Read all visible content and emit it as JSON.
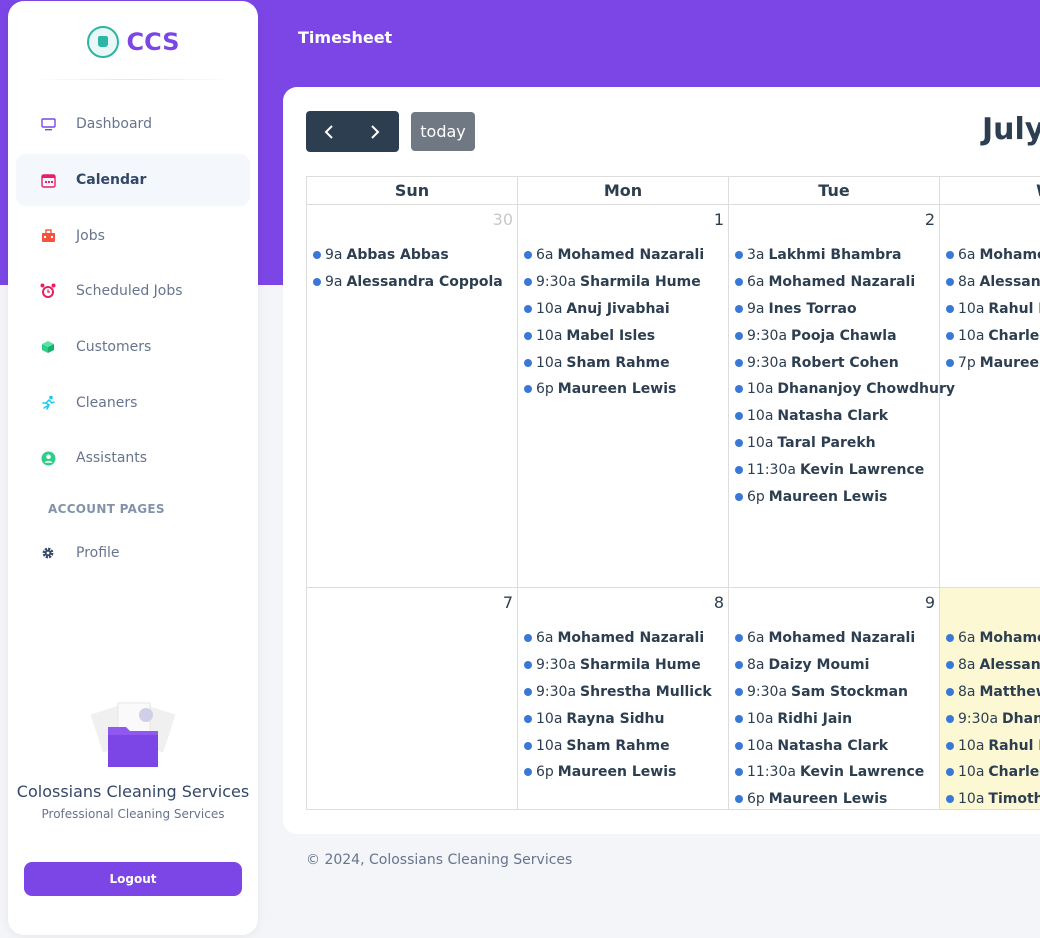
{
  "topbar": {
    "title": "Timesheet"
  },
  "sidebar": {
    "brand": "CCS",
    "items": [
      {
        "label": "Dashboard",
        "icon": "monitor-icon"
      },
      {
        "label": "Calendar",
        "icon": "calendar-icon",
        "active": true
      },
      {
        "label": "Jobs",
        "icon": "briefcase-icon"
      },
      {
        "label": "Scheduled Jobs",
        "icon": "alarm-clock-icon"
      },
      {
        "label": "Customers",
        "icon": "cube-icon"
      },
      {
        "label": "Cleaners",
        "icon": "running-person-icon"
      },
      {
        "label": "Assistants",
        "icon": "user-circle-icon"
      }
    ],
    "section_title": "ACCOUNT PAGES",
    "account_items": [
      {
        "label": "Profile",
        "icon": "gear-icon"
      }
    ],
    "promo": {
      "title": "Colossians Cleaning Services",
      "subtitle": "Professional Cleaning Services"
    },
    "logout_label": "Logout"
  },
  "calendar": {
    "title": "July",
    "today_label": "today",
    "headers": [
      "Sun",
      "Mon",
      "Tue",
      "W"
    ],
    "weeks": [
      {
        "days": [
          {
            "num": "30",
            "other": true,
            "events": [
              {
                "time": "9a",
                "title": "Abbas Abbas"
              },
              {
                "time": "9a",
                "title": "Alessandra Coppola"
              }
            ]
          },
          {
            "num": "1",
            "events": [
              {
                "time": "6a",
                "title": "Mohamed Nazarali"
              },
              {
                "time": "9:30a",
                "title": "Sharmila Hume"
              },
              {
                "time": "10a",
                "title": "Anuj Jivabhai"
              },
              {
                "time": "10a",
                "title": "Mabel Isles"
              },
              {
                "time": "10a",
                "title": "Sham Rahme"
              },
              {
                "time": "6p",
                "title": "Maureen Lewis"
              }
            ]
          },
          {
            "num": "2",
            "events": [
              {
                "time": "3a",
                "title": "Lakhmi Bhambra"
              },
              {
                "time": "6a",
                "title": "Mohamed Nazarali"
              },
              {
                "time": "9a",
                "title": "Ines Torrao"
              },
              {
                "time": "9:30a",
                "title": "Pooja Chawla"
              },
              {
                "time": "9:30a",
                "title": "Robert Cohen"
              },
              {
                "time": "10a",
                "title": "Dhananjoy Chowdhury"
              },
              {
                "time": "10a",
                "title": "Natasha Clark"
              },
              {
                "time": "10a",
                "title": "Taral Parekh"
              },
              {
                "time": "11:30a",
                "title": "Kevin Lawrence"
              },
              {
                "time": "6p",
                "title": "Maureen Lewis"
              }
            ]
          },
          {
            "num": "",
            "events": [
              {
                "time": "6a",
                "title": "Mohamed"
              },
              {
                "time": "8a",
                "title": "Alessandra"
              },
              {
                "time": "10a",
                "title": "Rahul Kh"
              },
              {
                "time": "10a",
                "title": "Charleen"
              },
              {
                "time": "7p",
                "title": "Maureen L"
              }
            ]
          }
        ]
      },
      {
        "days": [
          {
            "num": "7",
            "events": []
          },
          {
            "num": "8",
            "events": [
              {
                "time": "6a",
                "title": "Mohamed Nazarali"
              },
              {
                "time": "9:30a",
                "title": "Sharmila Hume"
              },
              {
                "time": "9:30a",
                "title": "Shrestha Mullick"
              },
              {
                "time": "10a",
                "title": "Rayna Sidhu"
              },
              {
                "time": "10a",
                "title": "Sham Rahme"
              },
              {
                "time": "6p",
                "title": "Maureen Lewis"
              }
            ]
          },
          {
            "num": "9",
            "events": [
              {
                "time": "6a",
                "title": "Mohamed Nazarali"
              },
              {
                "time": "8a",
                "title": "Daizy Moumi"
              },
              {
                "time": "9:30a",
                "title": "Sam Stockman"
              },
              {
                "time": "10a",
                "title": "Ridhi Jain"
              },
              {
                "time": "10a",
                "title": "Natasha Clark"
              },
              {
                "time": "11:30a",
                "title": "Kevin Lawrence"
              },
              {
                "time": "6p",
                "title": "Maureen Lewis"
              }
            ]
          },
          {
            "num": "",
            "today": true,
            "events": [
              {
                "time": "6a",
                "title": "Mohamed"
              },
              {
                "time": "8a",
                "title": "Alessandra"
              },
              {
                "time": "8a",
                "title": "Matthew t"
              },
              {
                "time": "9:30a",
                "title": "Dhanan"
              },
              {
                "time": "10a",
                "title": "Rahul Kh"
              },
              {
                "time": "10a",
                "title": "Charleen"
              },
              {
                "time": "10a",
                "title": "Timothy"
              }
            ]
          }
        ]
      }
    ]
  },
  "footer": {
    "text": "© 2024, Colossians Cleaning Services"
  }
}
